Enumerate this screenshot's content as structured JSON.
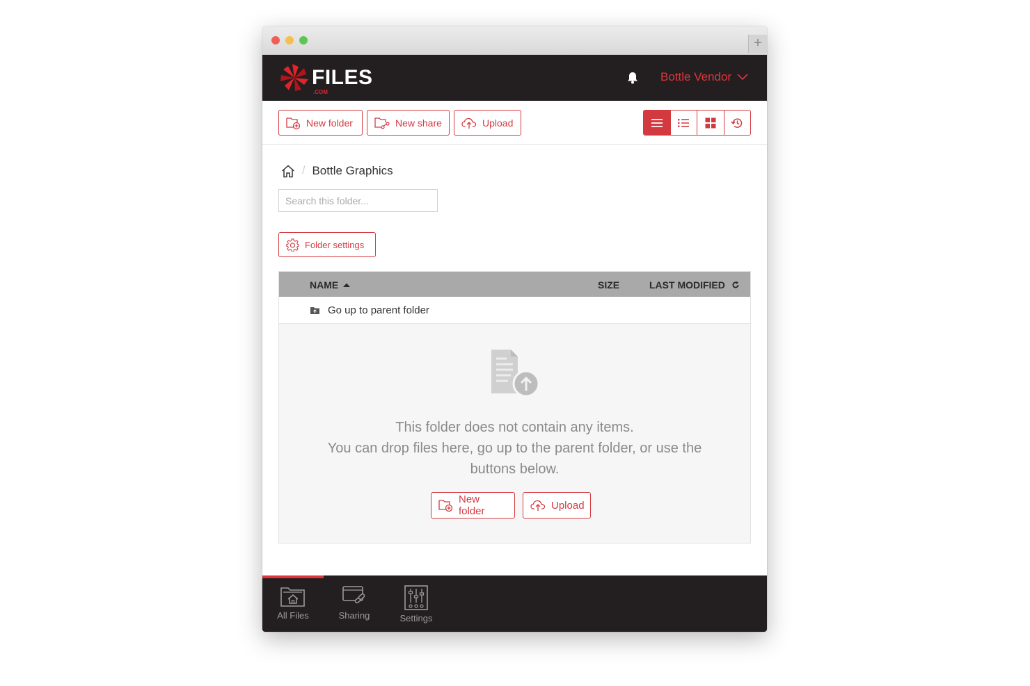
{
  "window": {
    "new_tab_symbol": "+"
  },
  "header": {
    "logo_text": "FILES",
    "logo_suffix": ".COM",
    "user_name": "Bottle Vendor"
  },
  "toolbar": {
    "new_folder_label": "New folder",
    "new_share_label": "New share",
    "upload_label": "Upload",
    "views": [
      "list",
      "detail",
      "grid",
      "history"
    ],
    "active_view": "list"
  },
  "breadcrumb": {
    "current": "Bottle Graphics",
    "separator": "/"
  },
  "search": {
    "placeholder": "Search this folder..."
  },
  "folder_settings": {
    "label": "Folder settings"
  },
  "table": {
    "columns": {
      "name": "NAME",
      "size": "SIZE",
      "last_modified": "LAST MODIFIED"
    },
    "parent_row": "Go up to parent folder"
  },
  "empty_state": {
    "line1": "This folder does not contain any items.",
    "line2": "You can drop files here, go up to the parent folder, or use the buttons below.",
    "new_folder_label": "New folder",
    "upload_label": "Upload"
  },
  "footer_nav": {
    "items": [
      {
        "label": "All Files",
        "icon": "folder-home-icon"
      },
      {
        "label": "Sharing",
        "icon": "share-link-icon"
      },
      {
        "label": "Settings",
        "icon": "sliders-icon"
      }
    ],
    "active": "All Files"
  },
  "colors": {
    "accent": "#d33a40",
    "header_bg": "#231f20",
    "table_header_bg": "#a9a9a9",
    "empty_bg": "#f6f6f6"
  }
}
